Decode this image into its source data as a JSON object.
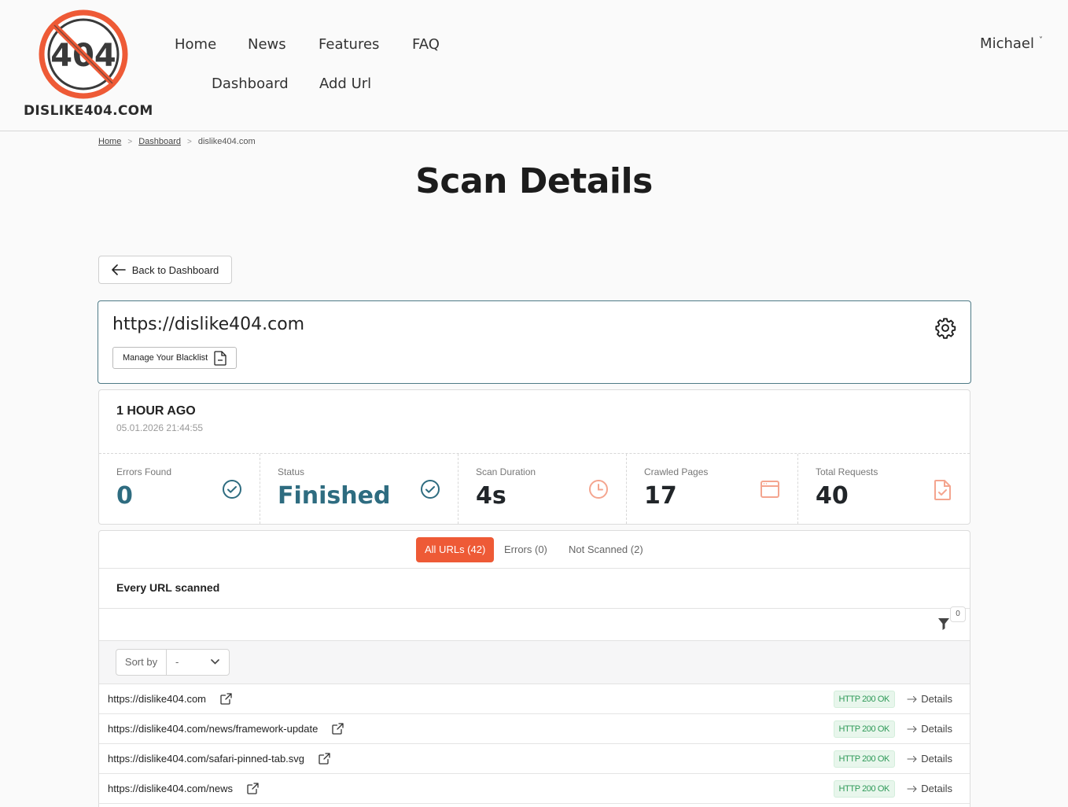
{
  "brand": {
    "name": "DISLIKE404.COM",
    "logo_text": "404"
  },
  "nav": {
    "home": "Home",
    "news": "News",
    "features": "Features",
    "faq": "FAQ",
    "dashboard": "Dashboard",
    "add_url": "Add Url"
  },
  "user": {
    "name": "Michael",
    "chevron": "˅"
  },
  "breadcrumb": {
    "home": "Home",
    "dashboard": "Dashboard",
    "current": "dislike404.com",
    "separator": ">"
  },
  "page": {
    "title": "Scan Details"
  },
  "back_button": {
    "label": "Back to Dashboard"
  },
  "site": {
    "url": "https://dislike404.com",
    "blacklist_label": "Manage Your Blacklist"
  },
  "scan": {
    "ago": "1 HOUR AGO",
    "date": "05.01.2026 21:44:55",
    "stats": [
      {
        "label": "Errors Found",
        "value": "0",
        "icon": "check-circle-icon",
        "color": "#2e6c80"
      },
      {
        "label": "Status",
        "value": "Finished",
        "icon": "check-circle-icon",
        "color": "#2e6c80"
      },
      {
        "label": "Scan Duration",
        "value": "4s",
        "icon": "clock-icon",
        "color": "#1c1c1c"
      },
      {
        "label": "Crawled Pages",
        "value": "17",
        "icon": "browser-window-icon",
        "color": "#1c1c1c"
      },
      {
        "label": "Total Requests",
        "value": "40",
        "icon": "document-check-icon",
        "color": "#1c1c1c"
      }
    ]
  },
  "tabs": {
    "all": "All URLs (42)",
    "errors": "Errors (0)",
    "not_scanned": "Not Scanned (2)"
  },
  "list": {
    "title": "Every URL scanned",
    "filter_count": "0",
    "sort_label": "Sort by",
    "sort_value": "-",
    "rows": [
      {
        "url": "https://dislike404.com",
        "status": "HTTP 200 OK",
        "action": "Details"
      },
      {
        "url": "https://dislike404.com/news/framework-update",
        "status": "HTTP 200 OK",
        "action": "Details"
      },
      {
        "url": "https://dislike404.com/safari-pinned-tab.svg",
        "status": "HTTP 200 OK",
        "action": "Details"
      },
      {
        "url": "https://dislike404.com/news",
        "status": "HTTP 200 OK",
        "action": "Details"
      },
      {
        "url": "",
        "status": "",
        "action": ""
      }
    ]
  },
  "colors": {
    "accent": "#ee5a36",
    "teal": "#2e6c80",
    "success": "#2e9a58",
    "icon_salmon": "#f4a58f"
  }
}
